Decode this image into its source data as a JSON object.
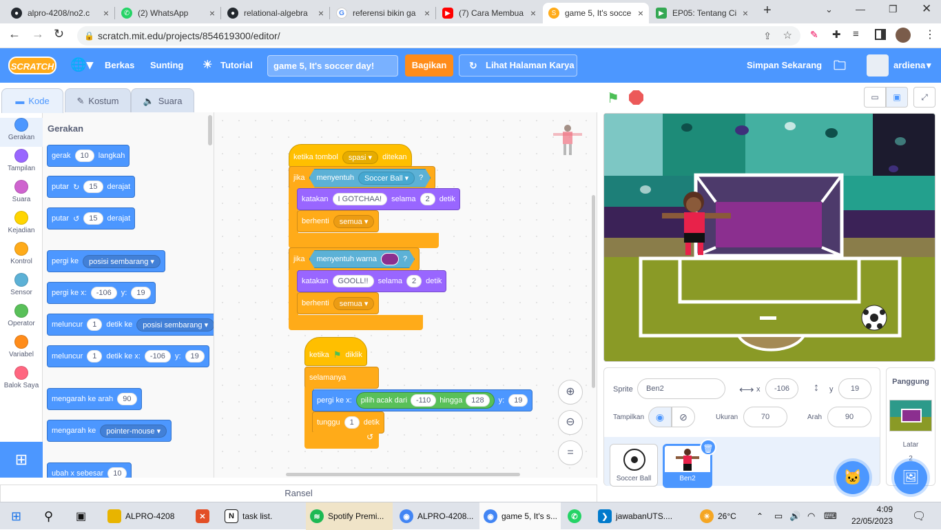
{
  "browser": {
    "tabs": [
      {
        "title": "alpro-4208/no2.c",
        "icon": "github-icon",
        "color": "#24292f"
      },
      {
        "title": "(2) WhatsApp",
        "icon": "whatsapp-icon",
        "color": "#25d366"
      },
      {
        "title": "relational-algebra",
        "icon": "github-icon",
        "color": "#24292f"
      },
      {
        "title": "referensi bikin ga",
        "icon": "google-icon",
        "color": "#4285f4"
      },
      {
        "title": "(7) Cara Membua",
        "icon": "youtube-icon",
        "color": "#ff0000"
      },
      {
        "title": "game 5, It's socce",
        "icon": "scratch-icon",
        "color": "#ffab19"
      },
      {
        "title": "EP05: Tentang Ci",
        "icon": "play-icon",
        "color": "#34a853"
      }
    ],
    "new_tab": "+",
    "url": "scratch.mit.edu/projects/854619300/editor/"
  },
  "menu": {
    "logo": "SCRATCH",
    "file": "Berkas",
    "edit": "Sunting",
    "tutorial": "Tutorial",
    "project_title": "game 5, It's soccer day!",
    "share": "Bagikan",
    "see_project": "Lihat Halaman Karya",
    "save_now": "Simpan Sekarang",
    "username": "ardiena"
  },
  "editor_tabs": {
    "code": "Kode",
    "costumes": "Kostum",
    "sounds": "Suara"
  },
  "categories": [
    {
      "label": "Gerakan",
      "color": "#4c97ff"
    },
    {
      "label": "Tampilan",
      "color": "#9966ff"
    },
    {
      "label": "Suara",
      "color": "#cf63cf"
    },
    {
      "label": "Kejadian",
      "color": "#ffd500"
    },
    {
      "label": "Kontrol",
      "color": "#ffab19"
    },
    {
      "label": "Sensor",
      "color": "#5cb1d6"
    },
    {
      "label": "Operator",
      "color": "#59c059"
    },
    {
      "label": "Variabel",
      "color": "#ff8c1a"
    },
    {
      "label": "Balok Saya",
      "color": "#ff6680"
    }
  ],
  "palette": {
    "heading": "Gerakan",
    "move": {
      "a": "gerak",
      "v": "10",
      "b": "langkah"
    },
    "turn_right": {
      "a": "putar",
      "v": "15",
      "b": "derajat"
    },
    "turn_left": {
      "a": "putar",
      "v": "15",
      "b": "derajat"
    },
    "goto": {
      "a": "pergi ke",
      "d": "posisi sembarang"
    },
    "goto_xy": {
      "a": "pergi ke x:",
      "x": "-106",
      "b": "y:",
      "y": "19"
    },
    "glide": {
      "a": "meluncur",
      "v": "1",
      "b": "detik ke",
      "d": "posisi sembarang"
    },
    "glide_xy": {
      "a": "meluncur",
      "v": "1",
      "b": "detik ke x:",
      "x": "-106",
      "c": "y:",
      "y": "19"
    },
    "point_dir": {
      "a": "mengarah ke arah",
      "v": "90"
    },
    "point_towards": {
      "a": "mengarah ke",
      "d": "pointer-mouse"
    },
    "change_x": {
      "a": "ubah x sebesar",
      "v": "10"
    }
  },
  "script1": {
    "hat": {
      "a": "ketika tombol",
      "d": "spasi",
      "b": "ditekan"
    },
    "if1": {
      "a": "jika",
      "b": "menyentuh",
      "d": "Soccer Ball",
      "q": "?"
    },
    "say1": {
      "a": "katakan",
      "v": "I GOTCHAA!",
      "b": "selama",
      "n": "2",
      "c": "detik"
    },
    "stop1": {
      "a": "berhenti",
      "d": "semua"
    },
    "if2": {
      "a": "jika",
      "b": "menyentuh warna",
      "q": "?",
      "swatch": "#8b2f8f"
    },
    "say2": {
      "a": "katakan",
      "v": "GOOLL!!",
      "b": "selama",
      "n": "2",
      "c": "detik"
    },
    "stop2": {
      "a": "berhenti",
      "d": "semua"
    }
  },
  "script2": {
    "hat": {
      "a": "ketika",
      "b": "diklik"
    },
    "forever": "selamanya",
    "goto": {
      "a": "pergi ke x:",
      "r": "pilih acak dari",
      "v1": "-110",
      "h": "hingga",
      "v2": "128",
      "y": "y:",
      "yv": "19"
    },
    "wait": {
      "a": "tunggu",
      "v": "1",
      "b": "detik"
    }
  },
  "backpack": "Ransel",
  "sprite_info": {
    "sprite_label": "Sprite",
    "sprite_name": "Ben2",
    "x_label": "x",
    "x": "-106",
    "y_label": "y",
    "y": "19",
    "show_label": "Tampilkan",
    "size_label": "Ukuran",
    "size": "70",
    "direction_label": "Arah",
    "direction": "90"
  },
  "sprites": [
    {
      "name": "Soccer Ball"
    },
    {
      "name": "Ben2"
    }
  ],
  "stage_panel": {
    "title": "Panggung",
    "backdrops_label": "Latar",
    "backdrops_count": "2"
  },
  "taskbar": {
    "items": [
      {
        "label": "ALPRO-4208",
        "color": "#e8b400"
      },
      {
        "label": "",
        "color": "#e34f26"
      },
      {
        "label": "task list.",
        "color": "#111"
      },
      {
        "label": "Spotify Premi...",
        "color": "#1db954"
      },
      {
        "label": "ALPRO-4208...",
        "color": "#4285f4"
      },
      {
        "label": "game 5, It's s...",
        "color": "#4285f4"
      },
      {
        "label": "",
        "color": "#25d366"
      },
      {
        "label": "jawabanUTS....",
        "color": "#007acc"
      }
    ],
    "weather": "26°C",
    "time": "4:09",
    "date": "22/05/2023"
  }
}
